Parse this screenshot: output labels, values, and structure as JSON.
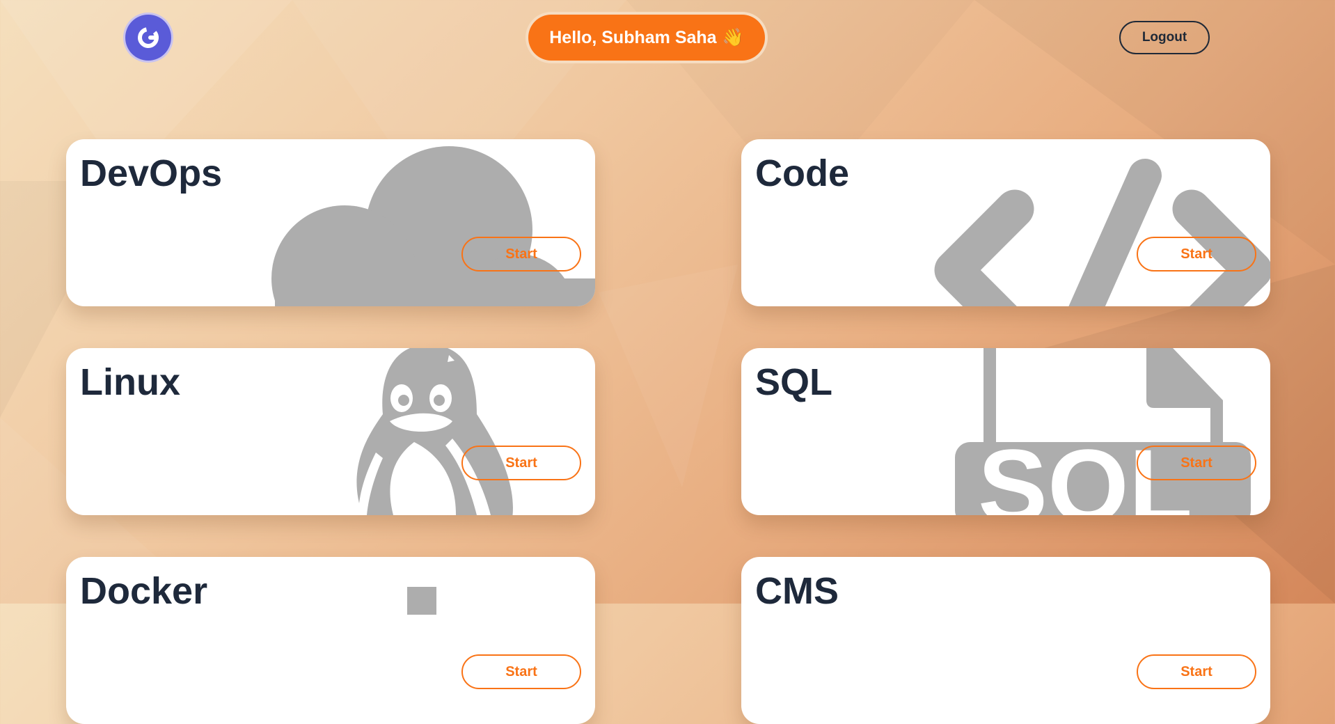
{
  "header": {
    "logo_letter": "G",
    "greeting": "Hello, Subham Saha",
    "greeting_emoji": "👋",
    "logout_label": "Logout"
  },
  "colors": {
    "accent": "#f97316",
    "logo": "#5a5bd8",
    "title": "#1e293b",
    "art": "#adadad"
  },
  "cards": [
    {
      "title": "DevOps",
      "start_label": "Start",
      "icon": "cloud-icon"
    },
    {
      "title": "Code",
      "start_label": "Start",
      "icon": "code-icon"
    },
    {
      "title": "Linux",
      "start_label": "Start",
      "icon": "penguin-icon"
    },
    {
      "title": "SQL",
      "start_label": "Start",
      "icon": "sql-file-icon"
    },
    {
      "title": "Docker",
      "start_label": "Start",
      "icon": "docker-icon"
    },
    {
      "title": "CMS",
      "start_label": "Start",
      "icon": "cms-icon"
    }
  ]
}
